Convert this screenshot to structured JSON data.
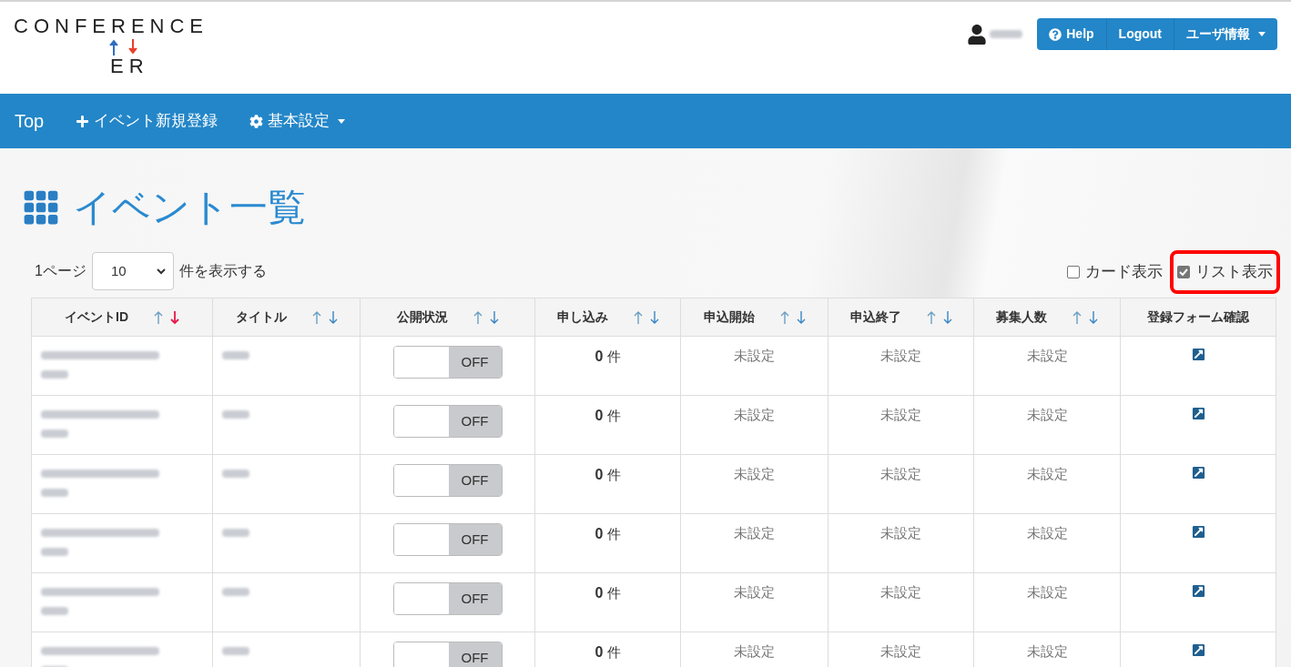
{
  "logo": {
    "top": "CONFERENCE",
    "bottom": "ER"
  },
  "header_buttons": [
    {
      "label": "Help",
      "kind": "help"
    },
    {
      "label": "Logout",
      "kind": "plain"
    },
    {
      "label": "ユーザ情報",
      "kind": "dropdown"
    }
  ],
  "nav": [
    {
      "label": "Top",
      "kind": "plain"
    },
    {
      "label": "イベント新規登録",
      "kind": "add"
    },
    {
      "label": "基本設定",
      "kind": "settings"
    }
  ],
  "page_title": "イベント一覧",
  "page_size": {
    "prefix": "1ページ",
    "value": "10",
    "suffix": "件を表示する"
  },
  "view_options": [
    {
      "label": "カード表示",
      "checked": false,
      "highlighted": false
    },
    {
      "label": "リスト表示",
      "checked": true,
      "highlighted": true
    }
  ],
  "table": {
    "columns": [
      {
        "label": "イベントID",
        "sortable": true,
        "sorted_desc": true
      },
      {
        "label": "タイトル",
        "sortable": true,
        "sorted_desc": false
      },
      {
        "label": "公開状況",
        "sortable": true,
        "sorted_desc": false
      },
      {
        "label": "申し込み",
        "sortable": true,
        "sorted_desc": false
      },
      {
        "label": "申込開始",
        "sortable": true,
        "sorted_desc": false
      },
      {
        "label": "申込終了",
        "sortable": true,
        "sorted_desc": false
      },
      {
        "label": "募集人数",
        "sortable": true,
        "sorted_desc": false
      },
      {
        "label": "登録フォーム確認",
        "sortable": false
      }
    ],
    "rows": [
      {
        "published": {
          "on": false,
          "label": "OFF"
        },
        "count": "0",
        "unit": "件",
        "start": "未設定",
        "end": "未設定",
        "capacity": "未設定"
      },
      {
        "published": {
          "on": false,
          "label": "OFF"
        },
        "count": "0",
        "unit": "件",
        "start": "未設定",
        "end": "未設定",
        "capacity": "未設定"
      },
      {
        "published": {
          "on": false,
          "label": "OFF"
        },
        "count": "0",
        "unit": "件",
        "start": "未設定",
        "end": "未設定",
        "capacity": "未設定"
      },
      {
        "published": {
          "on": false,
          "label": "OFF"
        },
        "count": "0",
        "unit": "件",
        "start": "未設定",
        "end": "未設定",
        "capacity": "未設定"
      },
      {
        "published": {
          "on": false,
          "label": "OFF"
        },
        "count": "0",
        "unit": "件",
        "start": "未設定",
        "end": "未設定",
        "capacity": "未設定"
      },
      {
        "published": {
          "on": false,
          "label": "OFF"
        },
        "count": "0",
        "unit": "件",
        "start": "未設定",
        "end": "未設定",
        "capacity": "未設定"
      }
    ]
  }
}
